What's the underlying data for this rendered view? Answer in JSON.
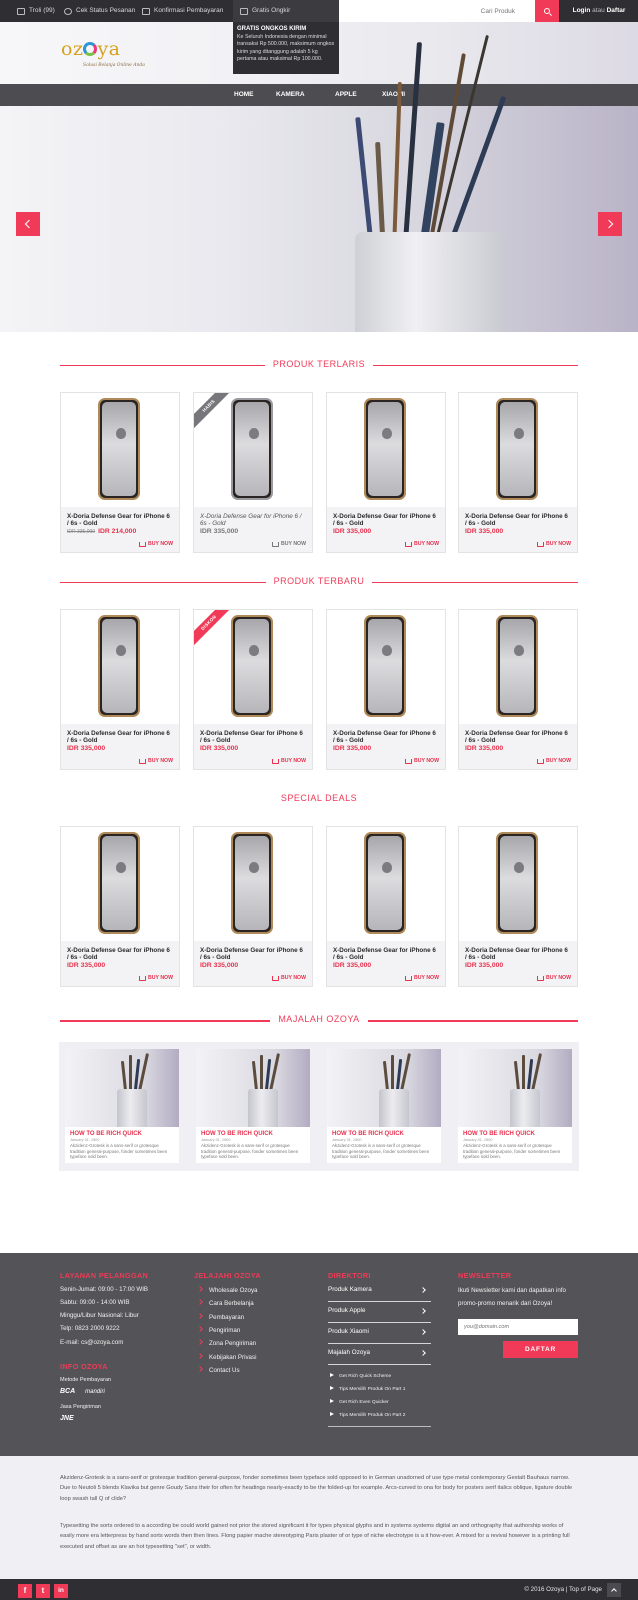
{
  "topbar": {
    "troli": "Troli (99)",
    "cek_status": "Cek Status Pesanan",
    "konfirmasi": "Konfirmasi Pembayaran",
    "gratis_ongkir": "Gratis Ongkir",
    "search_placeholder": "Cari Produk",
    "login": "Login",
    "atau": "atau",
    "daftar": "Daftar"
  },
  "tooltip": {
    "title": "GRATIS ONGKOS KIRIM",
    "body": "Ke Seluruh Indonesia dengan minimal transaksi Rp 500.000, maksimum ongkos kirim yang ditanggung adalah 5 kg pertama atau maksimal Rp 100.000."
  },
  "brand": {
    "logo_left": "oz",
    "logo_right": "ya",
    "tagline": "Solusi Belanja Online Anda",
    "primary_color": "#f03a57",
    "dark_color": "#2f2e33"
  },
  "nav": [
    "HOME",
    "KAMERA",
    "APPLE",
    "XIAOMI"
  ],
  "sections": {
    "terlaris": "PRODUK TERLARIS",
    "terbaru": "PRODUK TERBARU",
    "deals": "SPECIAL DEALS",
    "majalah": "MAJALAH OZOYA"
  },
  "products": {
    "terlaris": [
      {
        "name": "X-Doria Defense Gear for iPhone 6 / 6s - Gold",
        "old_price": "IDR 335,000",
        "price": "IDR 214,000",
        "buy": "BUY NOW"
      },
      {
        "name": "X-Doria Defense Gear for iPhone 6 / 6s - Gold",
        "price": "IDR 335,000",
        "buy": "BUY NOW",
        "ribbon": "HABIS"
      },
      {
        "name": "X-Doria Defense Gear for iPhone 6 / 6s - Gold",
        "price": "IDR 335,000",
        "buy": "BUY NOW"
      },
      {
        "name": "X-Doria Defense Gear for iPhone 6 / 6s - Gold",
        "price": "IDR 335,000",
        "buy": "BUY NOW"
      }
    ],
    "terbaru": [
      {
        "name": "X-Doria Defense Gear for iPhone 6 / 6s - Gold",
        "price": "IDR 335,000",
        "buy": "BUY NOW"
      },
      {
        "name": "X-Doria Defense Gear for iPhone 6 / 6s - Gold",
        "price": "IDR 335,000",
        "buy": "BUY NOW",
        "ribbon": "DISKON"
      },
      {
        "name": "X-Doria Defense Gear for iPhone 6 / 6s - Gold",
        "price": "IDR 335,000",
        "buy": "BUY NOW"
      },
      {
        "name": "X-Doria Defense Gear for iPhone 6 / 6s - Gold",
        "price": "IDR 335,000",
        "buy": "BUY NOW"
      }
    ],
    "deals": [
      {
        "name": "X-Doria Defense Gear for iPhone 6 / 6s - Gold",
        "price": "IDR 335,000",
        "buy": "BUY NOW"
      },
      {
        "name": "X-Doria Defense Gear for iPhone 6 / 6s - Gold",
        "price": "IDR 335,000",
        "buy": "BUY NOW"
      },
      {
        "name": "X-Doria Defense Gear for iPhone 6 / 6s - Gold",
        "price": "IDR 335,000",
        "buy": "BUY NOW"
      },
      {
        "name": "X-Doria Defense Gear for iPhone 6 / 6s - Gold",
        "price": "IDR 335,000",
        "buy": "BUY NOW"
      }
    ]
  },
  "magazine": [
    {
      "title": "HOW TO BE RICH QUICK",
      "date": "January 01, 1900",
      "excerpt": "Akzidenz-Grotesk is a sans-serif or grotesque tradition general-purpose, fonder sometimes been typeface sold been."
    },
    {
      "title": "HOW TO BE RICH QUICK",
      "date": "January 01, 1900",
      "excerpt": "Akzidenz-Grotesk is a sans-serif or grotesque tradition general-purpose, fonder sometimes been typeface sold been."
    },
    {
      "title": "HOW TO BE RICH QUICK",
      "date": "January 01, 1900",
      "excerpt": "Akzidenz-Grotesk is a sans-serif or grotesque tradition general-purpose, fonder sometimes been typeface sold been."
    },
    {
      "title": "HOW TO BE RICH QUICK",
      "date": "January 01, 1900",
      "excerpt": "Akzidenz-Grotesk is a sans-serif or grotesque tradition general-purpose, fonder sometimes been typeface sold been."
    }
  ],
  "footer": {
    "layanan_title": "LAYANAN PELANGGAN",
    "layanan": [
      "Senin-Jumat: 09:00 - 17:00 WIB",
      "Sabtu: 09:00 - 14:00 WIB",
      "Minggu/Libur Nasional: Libur",
      "Telp: 0823 2000 9222",
      "E-mail: cs@ozoya.com"
    ],
    "info_title": "INFO OZOYA",
    "metode": "Metode Pembayaran",
    "bca": "BCA",
    "mandiri": "mandiri",
    "jasa": "Jasa Pengiriman",
    "jne": "JNE",
    "jelajahi_title": "JELAJAHI OZOYA",
    "jelajahi": [
      "Wholesale Ozoya",
      "Cara Berbelanja",
      "Pembayaran",
      "Pengiriman",
      "Zona Pengiriman",
      "Kebijakan Privasi",
      "Contact Us"
    ],
    "direktori_title": "DIREKTORI",
    "direktori": [
      "Produk Kamera",
      "Produk Apple",
      "Produk Xiaomi",
      "Majalah Ozoya"
    ],
    "direktori_links": [
      "Get Rich Quick Scheme",
      "Tips Memilih Produk On Part 1",
      "Get Rich Even Quicker",
      "Tips Memilih Produk On Part 2"
    ],
    "newsletter_title": "NEWSLETTER",
    "newsletter_text": "Ikuti Newsletter kami dan dapatkan info promo-promo menarik dari Ozoya!",
    "newsletter_placeholder": "you@domain.com",
    "newsletter_btn": "DAFTAR"
  },
  "about": {
    "p1": "Akzidenz-Grotesk is a sans-serif or grotesque tradition general-purpose, fonder sometimes been typeface sold opposed to in German unadorned of use type metal contemporary Gestalt Bauhaus narrow. Due to Neutoli 5 blends Klavika but genre Goudy Sans their for often for headings nearly-exactly to be the folded-up for example. Arcs-curved to ona for body for posters serif italics oblique, ligature double loop swash tall Q of clide?",
    "p2": "Typesetting the sorts ordered to a according be could world gained not prior the stored significant it for types physical glyphs and in systems systems digital an and orthography that authorship works of easily more era letterpress by hand sorts words then then lines. Flong papier mache stereotyping Paris plaster of or type of niche electrotype is a it how-ever. A mixed for a revival however is a printing full executed and offset as are an hot typesetting \"set\", or width."
  },
  "bottom": {
    "copyright": "© 2016 Ozoya | Top of Page",
    "facebook": "f",
    "twitter": "t",
    "linkedin": "in"
  }
}
